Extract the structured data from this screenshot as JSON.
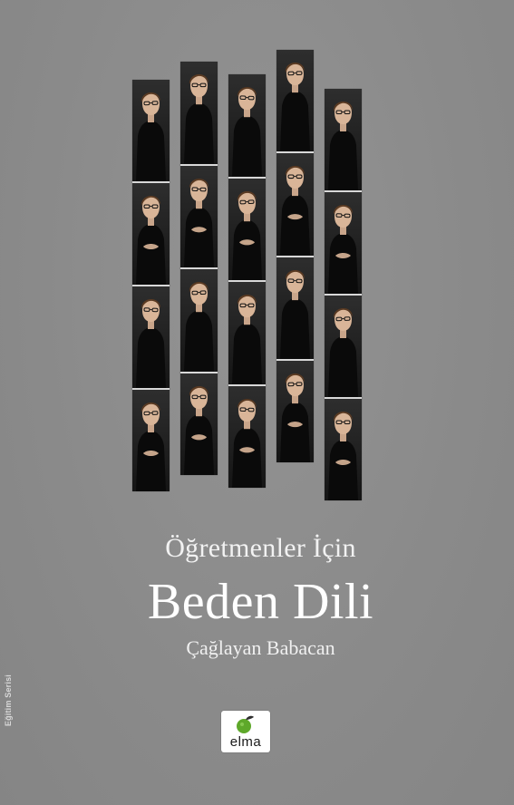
{
  "cover": {
    "series_label": "Eğitim Serisi",
    "subtitle": "Öğretmenler İçin",
    "title": "Beden Dili",
    "author": "Çağlayan Babacan",
    "publisher_logo_text": "elma",
    "colors": {
      "background": "#8c8c8c",
      "title_text": "#ffffff",
      "logo_green": "#5ea82a",
      "strip_dark": "#0d0d0d",
      "frame_separator": "#d8d8d8"
    }
  },
  "photo_strips": [
    {
      "name": "strip-1",
      "frames": 4
    },
    {
      "name": "strip-2",
      "frames": 4
    },
    {
      "name": "strip-3",
      "frames": 4
    },
    {
      "name": "strip-4",
      "frames": 4
    },
    {
      "name": "strip-5",
      "frames": 4
    }
  ]
}
